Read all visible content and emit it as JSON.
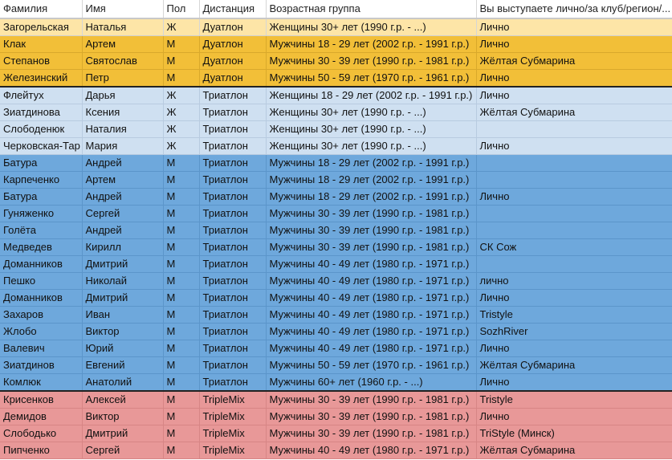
{
  "headers": [
    "Фамилия",
    "Имя",
    "Пол",
    "Дистанция",
    "Возрастная группа",
    "Вы выступаете лично/за клуб/регион/..."
  ],
  "rows": [
    {
      "group": "duathlon-first",
      "cells": [
        "Загорельская",
        "Наталья",
        "Ж",
        "Дуатлон",
        "Женщины 30+ лет (1990 г.р. - ...)",
        "Лично"
      ]
    },
    {
      "group": "duathlon",
      "cells": [
        "Клак",
        "Артем",
        "М",
        "Дуатлон",
        "Мужчины 18 - 29 лет (2002 г.р. - 1991 г.р.)",
        "Лично"
      ]
    },
    {
      "group": "duathlon",
      "cells": [
        "Степанов",
        "Святослав",
        "М",
        "Дуатлон",
        "Мужчины 30 - 39 лет (1990 г.р. - 1981 г.р.)",
        "Жёлтая Субмарина"
      ]
    },
    {
      "group": "duathlon",
      "cells": [
        "Железинский",
        "Петр",
        "М",
        "Дуатлон",
        "Мужчины 50 - 59 лет (1970 г.р. - 1961 г.р.)",
        "Лично"
      ]
    },
    {
      "group": "tri-light",
      "sep": true,
      "cells": [
        "Флейтух",
        "Дарья",
        "Ж",
        "Триатлон",
        "Женщины 18 - 29 лет (2002 г.р. - 1991 г.р.)",
        "Лично"
      ]
    },
    {
      "group": "tri-light",
      "cells": [
        "Зиатдинова",
        "Ксения",
        "Ж",
        "Триатлон",
        "Женщины 30+ лет (1990 г.р. - ...)",
        "Жёлтая Субмарина"
      ]
    },
    {
      "group": "tri-light",
      "cells": [
        "Слободенюк",
        "Наталия",
        "Ж",
        "Триатлон",
        "Женщины 30+ лет (1990 г.р. - ...)",
        ""
      ]
    },
    {
      "group": "tri-light",
      "cells": [
        "Черковская-Тар",
        "Мария",
        "Ж",
        "Триатлон",
        "Женщины 30+ лет (1990 г.р. - ...)",
        "Лично"
      ]
    },
    {
      "group": "tri-dark",
      "cells": [
        "Батура",
        "Андрей",
        "М",
        "Триатлон",
        "Мужчины 18 - 29 лет (2002 г.р. - 1991 г.р.)",
        ""
      ]
    },
    {
      "group": "tri-dark",
      "cells": [
        "Карпеченко",
        "Артем",
        "М",
        "Триатлон",
        "Мужчины 18 - 29 лет (2002 г.р. - 1991 г.р.)",
        ""
      ]
    },
    {
      "group": "tri-dark",
      "cells": [
        "Батура",
        "Андрей",
        "М",
        "Триатлон",
        "Мужчины 18 - 29 лет (2002 г.р. - 1991 г.р.)",
        "Лично"
      ]
    },
    {
      "group": "tri-dark",
      "cells": [
        "Гуняженко",
        "Сергей",
        "М",
        "Триатлон",
        "Мужчины 30 - 39 лет (1990 г.р. - 1981 г.р.)",
        ""
      ]
    },
    {
      "group": "tri-dark",
      "cells": [
        "Голёта",
        "Андрей",
        "М",
        "Триатлон",
        "Мужчины 30 - 39 лет (1990 г.р. - 1981 г.р.)",
        ""
      ]
    },
    {
      "group": "tri-dark",
      "cells": [
        "Медведев",
        "Кирилл",
        "М",
        "Триатлон",
        "Мужчины 30 - 39 лет (1990 г.р. - 1981 г.р.)",
        "СК Сож"
      ]
    },
    {
      "group": "tri-dark",
      "cells": [
        "Доманников",
        "Дмитрий",
        "М",
        "Триатлон",
        "Мужчины 40 - 49 лет (1980 г.р. - 1971 г.р.)",
        ""
      ]
    },
    {
      "group": "tri-dark",
      "cells": [
        "Пешко",
        "Николай",
        "М",
        "Триатлон",
        "Мужчины 40 - 49 лет (1980 г.р. - 1971 г.р.)",
        "лично"
      ]
    },
    {
      "group": "tri-dark",
      "cells": [
        "Доманников",
        "Дмитрий",
        "М",
        "Триатлон",
        "Мужчины 40 - 49 лет (1980 г.р. - 1971 г.р.)",
        "Лично"
      ]
    },
    {
      "group": "tri-dark",
      "cells": [
        "Захаров",
        "Иван",
        "М",
        "Триатлон",
        "Мужчины 40 - 49 лет (1980 г.р. - 1971 г.р.)",
        "Tristyle"
      ]
    },
    {
      "group": "tri-dark",
      "cells": [
        "Жлобо",
        "Виктор",
        "М",
        "Триатлон",
        "Мужчины 40 - 49 лет (1980 г.р. - 1971 г.р.)",
        "SozhRiver"
      ]
    },
    {
      "group": "tri-dark",
      "cells": [
        "Валевич",
        "Юрий",
        "М",
        "Триатлон",
        "Мужчины 40 - 49 лет (1980 г.р. - 1971 г.р.)",
        "Лично"
      ]
    },
    {
      "group": "tri-dark",
      "cells": [
        "Зиатдинов",
        "Евгений",
        "М",
        "Триатлон",
        "Мужчины 50 - 59 лет (1970 г.р. - 1961 г.р.)",
        "Жёлтая Субмарина"
      ]
    },
    {
      "group": "tri-dark",
      "cells": [
        "Комлюк",
        "Анатолий",
        "М",
        "Триатлон",
        "Мужчины 60+ лет (1960 г.р. - ...)",
        "Лично"
      ]
    },
    {
      "group": "triplemix",
      "sep": true,
      "cells": [
        "Крисенков",
        "Алексей",
        "М",
        "TripleMix",
        "Мужчины 30 - 39 лет (1990 г.р. - 1981 г.р.)",
        "Tristyle"
      ]
    },
    {
      "group": "triplemix",
      "cells": [
        "Демидов",
        "Виктор",
        "М",
        "TripleMix",
        "Мужчины 30 - 39 лет (1990 г.р. - 1981 г.р.)",
        "Лично"
      ]
    },
    {
      "group": "triplemix",
      "cells": [
        "Слободько",
        "Дмитрий",
        "М",
        "TripleMix",
        "Мужчины 30 - 39 лет (1990 г.р. - 1981 г.р.)",
        "TriStyle (Минск)"
      ]
    },
    {
      "group": "triplemix",
      "cells": [
        "Пипченко",
        "Сергей",
        "М",
        "TripleMix",
        "Мужчины 40 - 49 лет (1980 г.р. - 1971 г.р.)",
        "Жёлтая Субмарина"
      ]
    }
  ]
}
